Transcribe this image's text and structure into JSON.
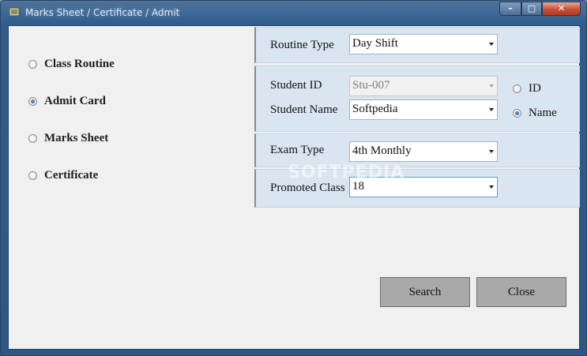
{
  "window": {
    "title": "Marks Sheet / Certificate / Admit"
  },
  "title_controls": {
    "minimize": "–",
    "maximize": "□",
    "close": "✕"
  },
  "report_options": [
    {
      "label": "Class Routine",
      "checked": false
    },
    {
      "label": "Admit Card",
      "checked": true
    },
    {
      "label": "Marks Sheet",
      "checked": false
    },
    {
      "label": "Certificate",
      "checked": false
    }
  ],
  "routine": {
    "label": "Routine Type",
    "value": "Day Shift"
  },
  "student": {
    "id_label": "Student ID",
    "id_value": "Stu-007",
    "name_label": "Student Name",
    "name_value": "Softpedia",
    "search_by": [
      {
        "label": "ID",
        "checked": false
      },
      {
        "label": "Name",
        "checked": true
      }
    ]
  },
  "exam": {
    "label": "Exam Type",
    "value": "4th Monthly"
  },
  "promoted": {
    "label": "Promoted Class",
    "value": "18"
  },
  "buttons": {
    "search": "Search",
    "close": "Close"
  },
  "watermark": "SOFTPEDIA"
}
